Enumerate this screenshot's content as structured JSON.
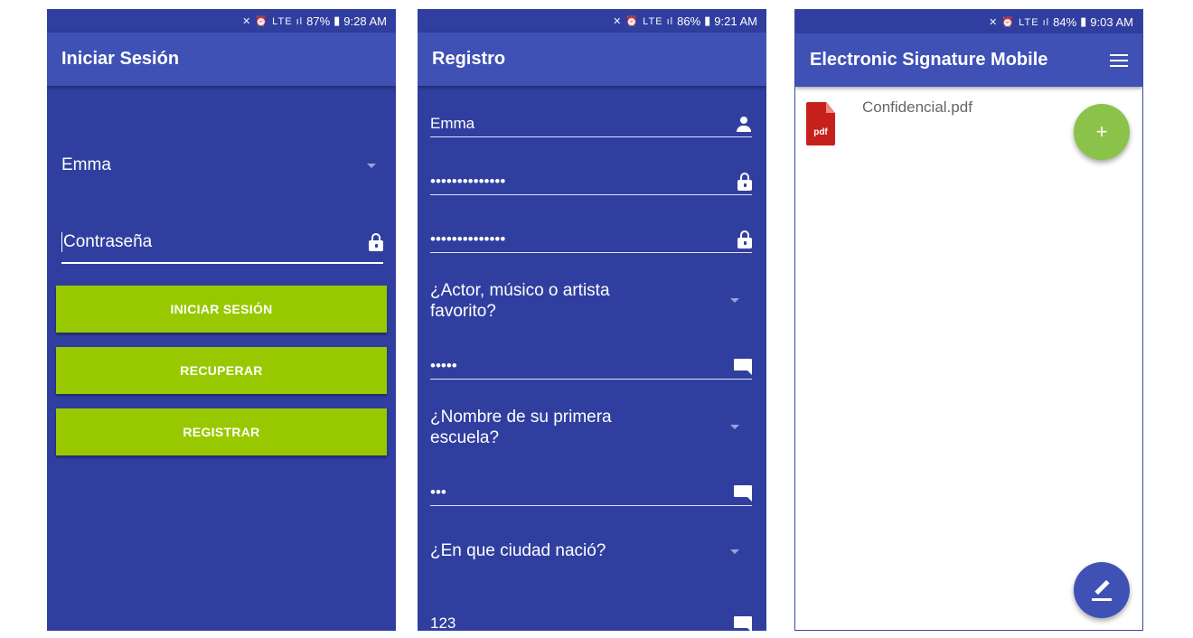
{
  "login": {
    "status": {
      "icons": "✕ ⏰ LTE ıl",
      "battery": "87%",
      "time": "9:28 AM"
    },
    "title": "Iniciar Sesión",
    "user_selected": "Emma",
    "password_placeholder": "Contraseña",
    "buttons": {
      "login": "INICIAR SESIÓN",
      "recover": "RECUPERAR",
      "register": "REGISTRAR"
    }
  },
  "register": {
    "status": {
      "icons": "✕ ⏰ LTE ıl",
      "battery": "86%",
      "time": "9:21 AM"
    },
    "title": "Registro",
    "username": "Emma",
    "password": "••••••••••••••",
    "password_confirm": "••••••••••••••",
    "question1": "¿Actor, músico o artista favorito?",
    "answer1": "•••••",
    "question2": "¿Nombre de su primera escuela?",
    "answer2": "•••",
    "question3": "¿En que ciudad nació?",
    "answer3": "123"
  },
  "documents": {
    "status": {
      "icons": "✕ ⏰ LTE ıl",
      "battery": "84%",
      "time": "9:03 AM"
    },
    "title": "Electronic Signature Mobile",
    "items": [
      {
        "name": "Confidencial.pdf",
        "type_label": "pdf"
      }
    ],
    "fab_add": "+"
  },
  "colors": {
    "primary": "#3f51b5",
    "primary_dark": "#303f9f",
    "accent_button": "#98c900",
    "fab_green": "#8bc34a",
    "pdf_red": "#c5201c"
  }
}
